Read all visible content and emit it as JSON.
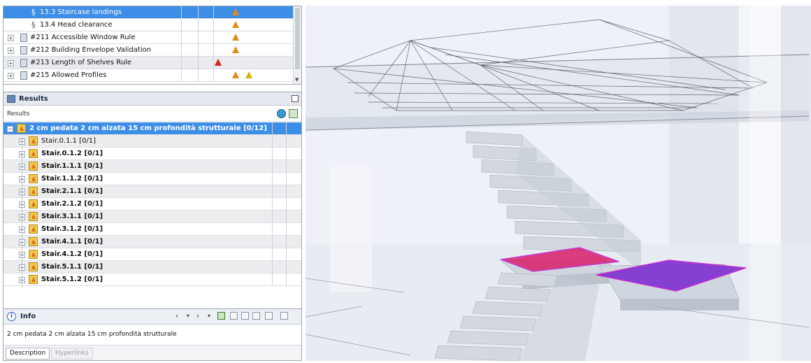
{
  "rules_tree": {
    "items": [
      {
        "label": "13.3 Staircase landings",
        "kind": "section",
        "selected": true
      },
      {
        "label": "13.4 Head clearance",
        "kind": "section",
        "selected": false
      },
      {
        "label": "#211 Accessible Window Rule",
        "kind": "rule",
        "selected": false
      },
      {
        "label": "#212 Building Envelope Validation",
        "kind": "rule",
        "selected": false
      },
      {
        "label": "#213 Length of Shelves Rule",
        "kind": "rule",
        "selected": false
      },
      {
        "label": "#215 Allowed Profiles",
        "kind": "rule",
        "selected": false
      }
    ]
  },
  "results": {
    "panel_title": "Results",
    "sub_label": "Results",
    "rows": [
      {
        "label": "2 cm pedata 2 cm alzata 15 cm profondità strutturale [0/12]",
        "selected": true
      },
      {
        "label": "Stair.0.1.1 [0/1]",
        "bold": false
      },
      {
        "label": "Stair.0.1.2 [0/1]",
        "bold": true
      },
      {
        "label": "Stair.1.1.1 [0/1]",
        "bold": true
      },
      {
        "label": "Stair.1.1.2 [0/1]",
        "bold": true
      },
      {
        "label": "Stair.2.1.1 [0/1]",
        "bold": true
      },
      {
        "label": "Stair.2.1.2 [0/1]",
        "bold": true
      },
      {
        "label": "Stair.3.1.1 [0/1]",
        "bold": true
      },
      {
        "label": "Stair.3.1.2 [0/1]",
        "bold": true
      },
      {
        "label": "Stair.4.1.1 [0/1]",
        "bold": true
      },
      {
        "label": "Stair.4.1.2 [0/1]",
        "bold": true
      },
      {
        "label": "Stair.5.1.1 [0/1]",
        "bold": true
      },
      {
        "label": "Stair.5.1.2 [0/1]",
        "bold": true
      }
    ]
  },
  "info": {
    "title": "Info",
    "text": "2 cm pedata 2 cm alzata 15 cm profondità strutturale",
    "tabs": [
      "Description",
      "Hyperlinks"
    ]
  },
  "icons": {
    "warning": "warning-icon",
    "error": "error-icon",
    "info": "info-icon",
    "back": "back-arrow-icon",
    "forward": "forward-arrow-icon"
  },
  "colors": {
    "selection": "#3d8ee6",
    "warning": "#e08a1e",
    "error": "#d32323",
    "highlight_red": "#d81f6a",
    "highlight_purple": "#7d2fd0"
  }
}
